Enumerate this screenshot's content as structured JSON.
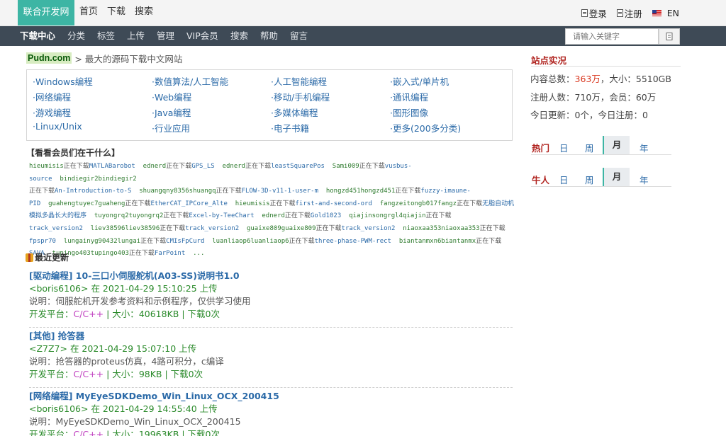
{
  "topbar": {
    "logo": "联合开发网",
    "nav": [
      "首页",
      "下载",
      "搜索"
    ],
    "login": "登录",
    "register": "注册",
    "lang": "EN"
  },
  "navbar": {
    "items": [
      "下载中心",
      "分类",
      "标签",
      "上传",
      "管理",
      "VIP会员",
      "搜索",
      "帮助",
      "留言"
    ],
    "search_placeholder": "请输入关键字"
  },
  "brand": {
    "logo": "Pudn.com",
    "tagline": "> 最大的源码下载中文网站"
  },
  "categories": [
    "·Windows编程",
    "·数值算法/人工智能",
    "·人工智能编程",
    "·嵌入式/单片机",
    "·网络编程",
    "·Web编程",
    "·移动/手机编程",
    "·通讯编程",
    "·游戏编程",
    "·Java编程",
    "·多媒体编程",
    "·图形图像",
    "·Linux/Unix",
    "·行业应用",
    "·电子书籍",
    "·更多(200多分类)"
  ],
  "watching": {
    "title": "【看看会员们在干什么】",
    "lines": [
      [
        [
          "u",
          "hieumisis"
        ],
        [
          "w",
          "正在下载"
        ],
        [
          "f",
          "MATLABarobot"
        ],
        [
          "s",
          "  "
        ],
        [
          "u",
          "ednerd"
        ],
        [
          "w",
          "正在下载"
        ],
        [
          "f",
          "GPS_LS"
        ],
        [
          "s",
          "  "
        ],
        [
          "u",
          "ednerd"
        ],
        [
          "w",
          "正在下载"
        ],
        [
          "f",
          "leastSquarePos"
        ],
        [
          "s",
          "  "
        ],
        [
          "u",
          "Sami009"
        ],
        [
          "w",
          "正在下载"
        ],
        [
          "f",
          "vusbus-source"
        ],
        [
          "s",
          "  "
        ],
        [
          "u",
          "bindiegir2bindiegir2"
        ]
      ],
      [
        [
          "w",
          "正在下载"
        ],
        [
          "f",
          "An-Introduction-to-S"
        ],
        [
          "s",
          "  "
        ],
        [
          "u",
          "shuangqny8356shuangq"
        ],
        [
          "w",
          "正在下载"
        ],
        [
          "f",
          "FLOW-3D-v11-1-user-m"
        ],
        [
          "s",
          "  "
        ],
        [
          "u",
          "hongzd451hongzd451"
        ],
        [
          "w",
          "正在下载"
        ],
        [
          "f",
          "fuzzy-imaune-"
        ]
      ],
      [
        [
          "f",
          "PID"
        ],
        [
          "s",
          "  "
        ],
        [
          "u",
          "guahengtuyec7guaheng"
        ],
        [
          "w",
          "正在下载"
        ],
        [
          "f",
          "EtherCAT_IPCore_Alte"
        ],
        [
          "s",
          "  "
        ],
        [
          "u",
          "hieumisis"
        ],
        [
          "w",
          "正在下载"
        ],
        [
          "f",
          "first-and-second-ord"
        ],
        [
          "s",
          "  "
        ],
        [
          "u",
          "fangzeitongb017fangz"
        ],
        [
          "w",
          "正在下载"
        ],
        [
          "f",
          "无脂自动机"
        ]
      ],
      [
        [
          "f",
          "模拟多晶长大的程序"
        ],
        [
          "s",
          "  "
        ],
        [
          "u",
          "tuyongrq2tuyongrq2"
        ],
        [
          "w",
          "正在下载"
        ],
        [
          "f",
          "Excel-by-TeeChart"
        ],
        [
          "s",
          "  "
        ],
        [
          "u",
          "ednerd"
        ],
        [
          "w",
          "正在下载"
        ],
        [
          "f",
          "Gold1023"
        ],
        [
          "s",
          "  "
        ],
        [
          "u",
          "qiajinsongrgl4qiajin"
        ],
        [
          "w",
          "正在下载"
        ]
      ],
      [
        [
          "f",
          "track_version2"
        ],
        [
          "s",
          "  "
        ],
        [
          "u",
          "liev38596liev38596"
        ],
        [
          "w",
          "正在下载"
        ],
        [
          "f",
          "track_version2"
        ],
        [
          "s",
          "  "
        ],
        [
          "u",
          "guaixe809guaixe809"
        ],
        [
          "w",
          "正在下载"
        ],
        [
          "f",
          "track_version2"
        ],
        [
          "s",
          "  "
        ],
        [
          "u",
          "niaoxaa353niaoxaa353"
        ],
        [
          "w",
          "正在下载"
        ]
      ],
      [
        [
          "f",
          "fpspr70"
        ],
        [
          "s",
          "  "
        ],
        [
          "u",
          "lungainyg90432lungai"
        ],
        [
          "w",
          "正在下载"
        ],
        [
          "f",
          "CMIsFpCurd"
        ],
        [
          "s",
          "  "
        ],
        [
          "u",
          "luanliaop6luanliaop6"
        ],
        [
          "w",
          "正在下载"
        ],
        [
          "f",
          "three-phase-PWM-rect"
        ],
        [
          "s",
          "  "
        ],
        [
          "u",
          "biantanmxn6biantanmx"
        ],
        [
          "w",
          "正在下载"
        ]
      ],
      [
        [
          "f",
          "SAVA"
        ],
        [
          "s",
          "  "
        ],
        [
          "u",
          "tupingo403tupingo403"
        ],
        [
          "w",
          "正在下载"
        ],
        [
          "f",
          "FarPoint"
        ],
        [
          "s",
          "  "
        ],
        [
          "u",
          "..."
        ]
      ]
    ]
  },
  "recent": {
    "title": "最近更新",
    "entries": [
      {
        "title": "[驱动编程] 10-三口小伺服舵机(A03-SS)说明书1.0",
        "user_line": "<boris6106> 在 2021-04-29 15:10:25 上传",
        "desc": "说明：伺服舵机开发参考资料和示例程序，仅供学习使用",
        "platform_label": "开发平台：",
        "platform": "C/C++",
        "size_label": " | 大小：",
        "size": "40618KB",
        "downloads": " | 下载0次"
      },
      {
        "title": "[其他] 抢答器",
        "user_line": "<Z7Z7> 在 2021-04-29 15:07:10 上传",
        "desc": "说明：抢答器的proteus仿真，4路可积分，c编译",
        "platform_label": "开发平台：",
        "platform": "C/C++",
        "size_label": " | 大小：",
        "size": "98KB",
        "downloads": " | 下载0次"
      },
      {
        "title": "[网络编程] MyEyeSDKDemo_Win_Linux_OCX_200415",
        "user_line": "<boris6106> 在 2021-04-29 14:55:40 上传",
        "desc": "说明：MyEyeSDKDemo_Win_Linux_OCX_200415",
        "platform_label": "开发平台：",
        "platform": "C/C++",
        "size_label": " | 大小：",
        "size": "19963KB",
        "downloads": " | 下载0次"
      }
    ]
  },
  "sidebar": {
    "title": "站点实况",
    "stats": {
      "content_label": "内容总数：",
      "content_value": "363万",
      "content_size": "，大小：5510GB",
      "users": "注册人数：710万，会员：60万",
      "today": "今日更新：0个，今日注册：0"
    },
    "hot": {
      "label": "热门",
      "tabs": [
        "日",
        "周",
        "月",
        "年"
      ],
      "selected": "月"
    },
    "niu": {
      "label": "牛人",
      "tabs": [
        "日",
        "周",
        "月",
        "年"
      ],
      "selected": "月"
    }
  },
  "colors": {
    "accent": "#3db5a4",
    "navbar": "#3e4a56",
    "link": "#2b6aa8",
    "green": "#2a8a2a",
    "red": "#b0221e"
  }
}
